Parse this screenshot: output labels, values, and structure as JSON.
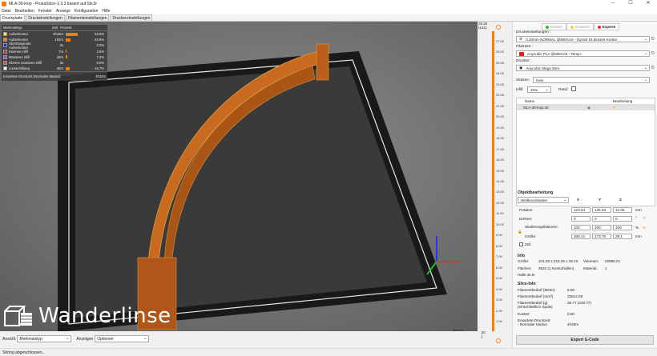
{
  "window": {
    "title": "MLA-30-loop - PrusaSlicer-2.3.3 basiert auf Slic3r",
    "minimize": "–",
    "maximize": "☐",
    "close": "✕"
  },
  "menu": [
    "Datei",
    "Bearbeiten",
    "Fenster",
    "Anzeige",
    "Konfiguration",
    "Hilfe"
  ],
  "tabs": [
    "Druckplatte",
    "Druckeinstellungen",
    "Filamenteinstellungen",
    "Druckereinstellungen"
  ],
  "legend": {
    "headers": [
      "Merkmalstyp",
      "Zeit",
      "Prozent"
    ],
    "rows": [
      {
        "label": "Außenkontur",
        "time": "2h18m",
        "percent": "53.5%",
        "color": "#ffe04a",
        "fraction": 0.535
      },
      {
        "label": "Außenkontur",
        "time": "1h2m",
        "percent": "22.9%",
        "color": "#ff7a00",
        "fraction": 0.229
      },
      {
        "label": "Überhängende Außenkontur",
        "time": "2s",
        "percent": "0.0%",
        "color": "#2222dd",
        "fraction": 0.0
      },
      {
        "label": "Internes Infill",
        "time": "7m",
        "percent": "2.6%",
        "color": "#b03c3c",
        "fraction": 0.026
      },
      {
        "label": "Massives Infill",
        "time": "20m",
        "percent": "7.2%",
        "color": "#9a4dcc",
        "fraction": 0.072
      },
      {
        "label": "Oberes massives Infill",
        "time": "3s",
        "percent": "0.0%",
        "color": "#ff3a3a",
        "fraction": 0.0
      },
      {
        "label": "Lückenfüllung",
        "time": "46m",
        "percent": "16.7%",
        "color": "#ffffff",
        "fraction": 0.167
      }
    ],
    "footer_label": "Erwartete Druckzeit (Normaler Modus):",
    "footer_value": "4h33m"
  },
  "watermark": "Wanderlinse",
  "vslider": {
    "top_value": "28.20",
    "top_layer": "(141)",
    "bottom_value": "0.20",
    "bottom_layer": "(1)",
    "ticks": [
      "27.00",
      "26.00",
      "25.00",
      "24.00",
      "23.00",
      "22.00",
      "21.00",
      "20.00",
      "19.00",
      "18.00",
      "17.00",
      "16.00",
      "15.00",
      "14.00",
      "13.00",
      "12.00",
      "11.00",
      "10.00",
      "9.00",
      "8.00",
      "7.00",
      "6.00",
      "5.00",
      "4.00",
      "3.00",
      "2.00",
      "1.00"
    ]
  },
  "hslider": {
    "left": "93423",
    "right": "94626"
  },
  "bottombar": {
    "view_label": "Ansicht",
    "view_value": "Merkmalstyp",
    "show_label": "Anzeigen",
    "show_value": "Optionen"
  },
  "status": "Slicing abgeschlossen...",
  "modes": [
    {
      "label": "Einfach",
      "color": "#2cbb2c"
    },
    {
      "label": "Erweitert",
      "color": "#f2d23a"
    },
    {
      "label": "Experte",
      "color": "#e33030"
    }
  ],
  "print_settings_label": "Druckeinstellungen :",
  "print_settings_value": "0.20mm NORMAL @MEGA0 - Gyroid 15 dickere Kontur",
  "filament_label": "Filament :",
  "filament_value": "Anycubic PLA @MEGA0 - Temp+",
  "filament_color": "#e0241a",
  "printer_label": "Drucker :",
  "printer_value": "Anycubic Mega Zero",
  "supports_label": "Stützen:",
  "supports_value": "Kein",
  "infill_label": "Infill:",
  "infill_value": "15%",
  "brim_label": "Rand:",
  "objlist": {
    "col_name": "Name",
    "col_edit": "Bearbeitung",
    "rows": [
      {
        "name": "MLA-30-loop.stl"
      }
    ]
  },
  "objmanip": {
    "title": "Objektbearbeitung",
    "coord_select": "Weltkoordinaten",
    "axes": [
      "X",
      "Y",
      "Z"
    ],
    "position_label": "Position:",
    "position": [
      "123.64",
      "125.63",
      "14.05"
    ],
    "rotation_label": "Drehen:",
    "rotation": [
      "0",
      "0",
      "0"
    ],
    "scale_label": "Skalierungsfaktoren:",
    "scale": [
      "100",
      "100",
      "100"
    ],
    "size_label": "Größe:",
    "size": [
      "206.14",
      "173.76",
      "28.1"
    ],
    "unit_mm": "mm",
    "unit_deg": "°",
    "unit_pct": "%",
    "inch_label": "Zoll"
  },
  "info": {
    "title": "Info",
    "size_label": "Größe:",
    "size_value": "241.83 x 216.25 x 28.10",
    "volume_label": "Volumen:",
    "volume_value": "22996.21",
    "facets_label": "Flächen:",
    "facets_value": "3522 (1 Konturhüllen)",
    "material_label": "Material:",
    "material_value": "1",
    "manifold_label": "Hülle ok.le"
  },
  "sliced": {
    "title": "Slice-Info",
    "rows": [
      {
        "label": "Filamentbedarf (Meter)",
        "value": "9.00"
      },
      {
        "label": "Filamentbedarf (mm³)",
        "value": "23812.09"
      },
      {
        "label": "Filamentbedarf (g)\n(einschließlich Spule)",
        "value": "29.77 (249.77)"
      },
      {
        "label": "Kosten:",
        "value": "0.60"
      },
      {
        "label": "Erwartete Druckzeit:\n - Normaler Modus",
        "value": "4h33m"
      }
    ]
  },
  "export_label": "Export G-Code",
  "colors": {
    "accent": "#ff7a00",
    "model": "#c86a1f"
  }
}
